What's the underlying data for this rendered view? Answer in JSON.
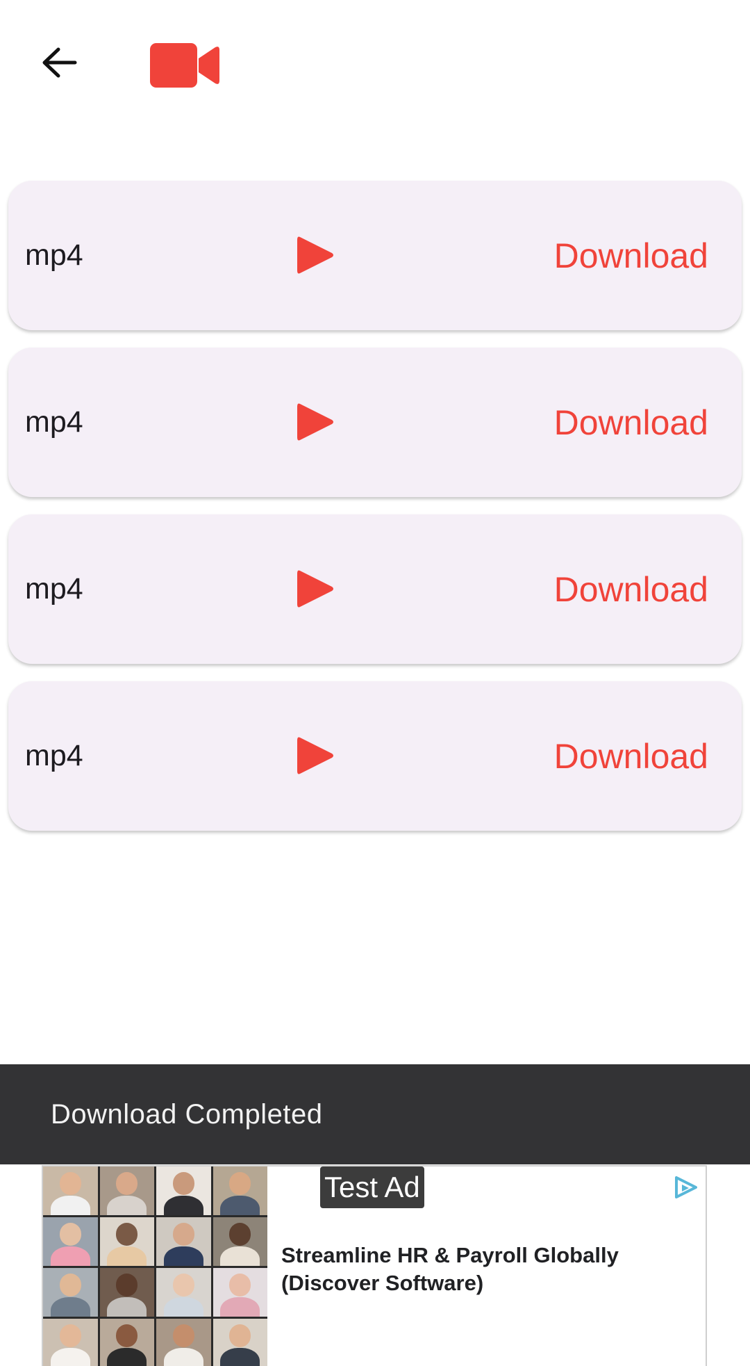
{
  "top_bar": {
    "back_icon": "arrow-left-icon",
    "logo_icon": "video-camera-icon",
    "accent_color": "#f0433a"
  },
  "formats": [
    {
      "label": "mp4",
      "play_icon": "play-icon",
      "download_label": "Download"
    },
    {
      "label": "mp4",
      "play_icon": "play-icon",
      "download_label": "Download"
    },
    {
      "label": "mp4",
      "play_icon": "play-icon",
      "download_label": "Download"
    },
    {
      "label": "mp4",
      "play_icon": "play-icon",
      "download_label": "Download"
    }
  ],
  "snackbar": {
    "message": "Download Completed"
  },
  "ad": {
    "badge": "Test Ad",
    "headline": "Streamline HR & Payroll Globally (Discover Software)",
    "adchoices_icon": "adchoices-icon"
  }
}
